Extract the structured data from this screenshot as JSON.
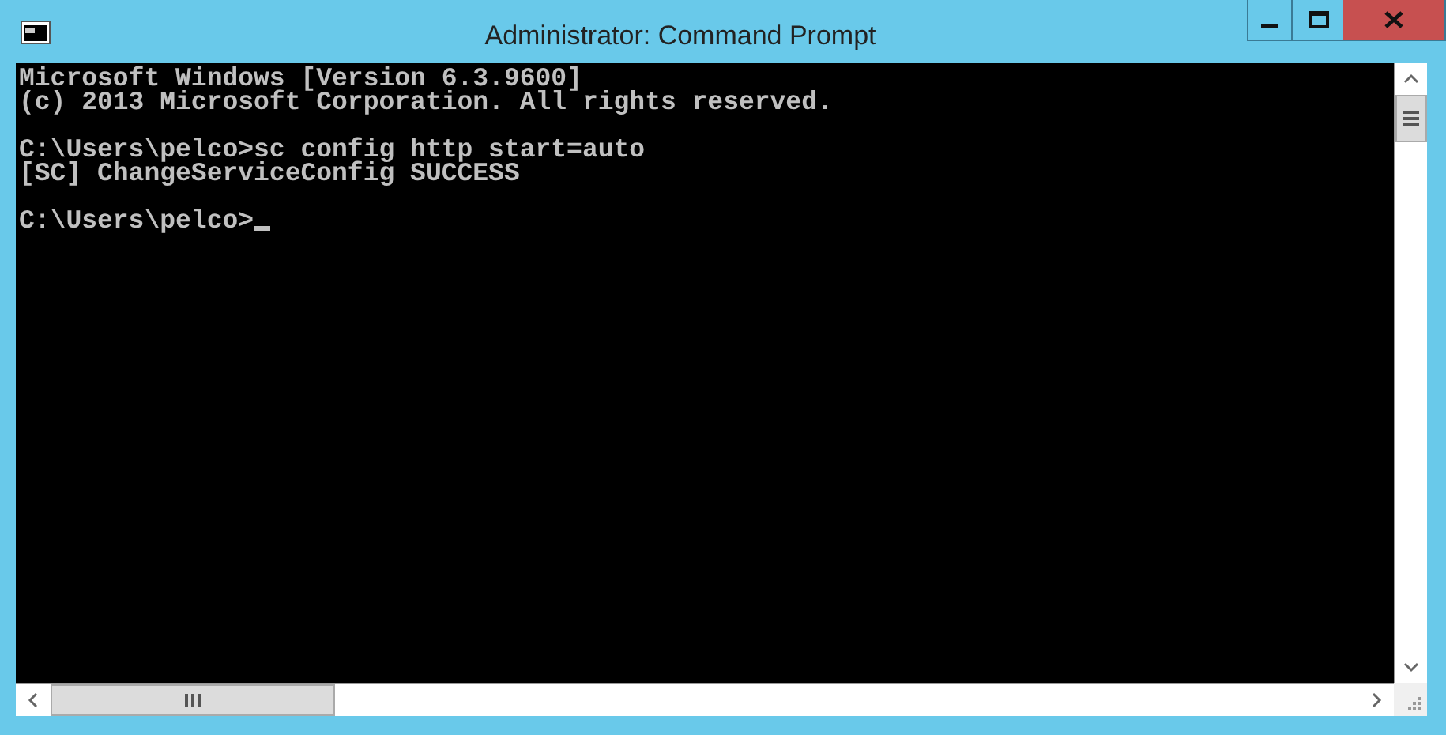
{
  "window": {
    "title": "Administrator: Command Prompt"
  },
  "console": {
    "blocks": [
      {
        "lines": [
          "Microsoft Windows [Version 6.3.9600]",
          "(c) 2013 Microsoft Corporation. All rights reserved."
        ]
      },
      {
        "lines": [
          "C:\\Users\\pelco>sc config http start=auto",
          "[SC] ChangeServiceConfig SUCCESS"
        ]
      },
      {
        "lines": [
          "C:\\Users\\pelco>"
        ]
      }
    ],
    "cursor_visible": true
  }
}
